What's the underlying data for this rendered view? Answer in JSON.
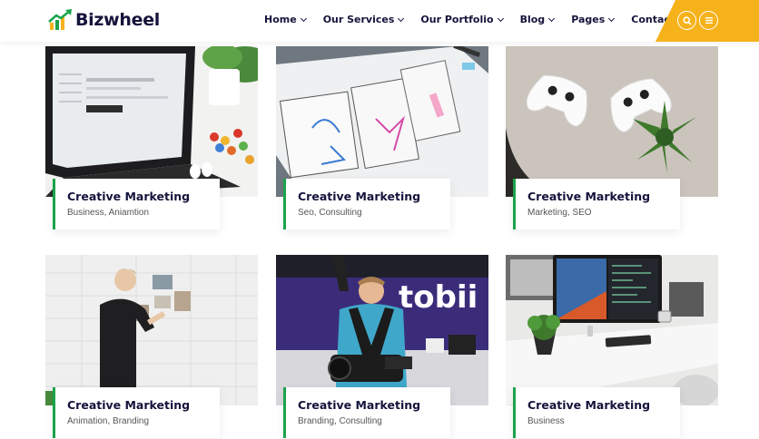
{
  "brand": {
    "name": "Bizwheel",
    "accent": "#f5b21b",
    "green": "#1aa34a",
    "navy": "#14133b"
  },
  "nav": [
    {
      "label": "Home",
      "has_dropdown": true
    },
    {
      "label": "Our Services",
      "has_dropdown": true
    },
    {
      "label": "Our Portfolio",
      "has_dropdown": true
    },
    {
      "label": "Blog",
      "has_dropdown": true
    },
    {
      "label": "Pages",
      "has_dropdown": true
    },
    {
      "label": "Contact Us",
      "has_dropdown": false
    }
  ],
  "header_actions": {
    "search_icon": "search-icon",
    "menu_icon": "menu-icon"
  },
  "portfolio": [
    {
      "title": "Creative Marketing",
      "tags": "Business, Aniamtion",
      "image": "laptop-on-desk"
    },
    {
      "title": "Creative Marketing",
      "tags": "Seo, Consulting",
      "image": "wireframe-sketches"
    },
    {
      "title": "Creative Marketing",
      "tags": "Marketing, SEO",
      "image": "game-controllers"
    },
    {
      "title": "Creative Marketing",
      "tags": "Animation, Branding",
      "image": "man-pinning-photos"
    },
    {
      "title": "Creative Marketing",
      "tags": "Branding, Consulting",
      "image": "cameraman-tobii",
      "image_text": "tobii"
    },
    {
      "title": "Creative Marketing",
      "tags": "Business",
      "image": "desk-monitor"
    }
  ]
}
